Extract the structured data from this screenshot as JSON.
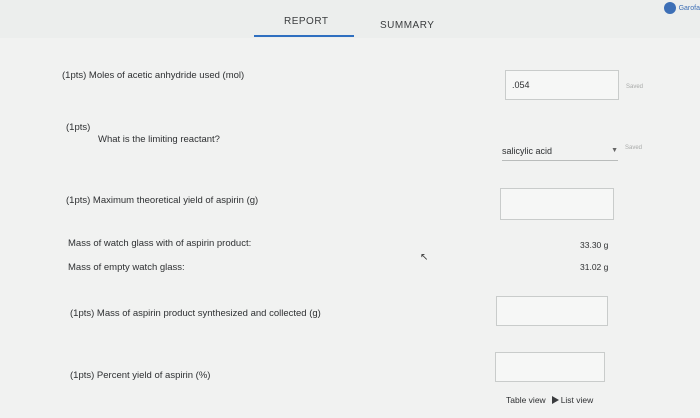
{
  "header": {
    "tabs": [
      {
        "label": "REPORT",
        "active": true
      },
      {
        "label": "SUMMARY",
        "active": false
      }
    ],
    "user_name": "Garofa",
    "accent_color": "#2f6fc0"
  },
  "questions": {
    "q1": {
      "label": "(1pts)  Moles of acetic anhydride used (mol)",
      "value": ".054",
      "status": "Saved"
    },
    "q2": {
      "points": "(1pts)",
      "label": "What is the limiting reactant?",
      "selected": "salicylic acid",
      "status": "Saved"
    },
    "q3": {
      "label": "(1pts)  Maximum theoretical yield of aspirin (g)",
      "value": ""
    },
    "measurements": [
      {
        "label": "Mass of watch glass with of aspirin product:",
        "value": "33.30 g"
      },
      {
        "label": "Mass of empty watch glass:",
        "value": "31.02 g"
      }
    ],
    "q4": {
      "label": "(1pts)  Mass of aspirin product synthesized and collected (g)",
      "value": ""
    },
    "q5": {
      "label": "(1pts)  Percent yield of aspirin (%)",
      "value": ""
    }
  },
  "footer": {
    "table_view": "Table view",
    "list_view": "List view"
  }
}
